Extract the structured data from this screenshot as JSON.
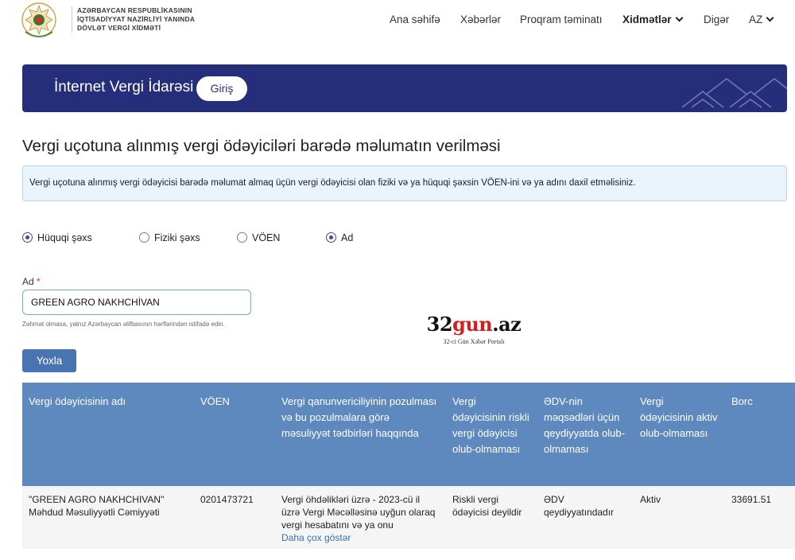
{
  "header": {
    "org_line1": "AZƏRBAYCAN RESPUBLİKASININ",
    "org_line2": "İQTİSADİYYAT NAZİRLİYİ YANINDA",
    "org_line3": "DÖVLƏT VERGİ XİDMƏTİ",
    "emblem_icon": "state-emblem-icon",
    "nav": {
      "home": "Ana səhifə",
      "news": "Xəbərlər",
      "software": "Proqram təminatı",
      "services": "Xidmətlər",
      "other": "Digər",
      "language": "AZ"
    }
  },
  "banner": {
    "title": "İnternet Vergi İdarəsi",
    "login_label": "Giriş",
    "background": "#252e7b"
  },
  "page_title": "Vergi uçotuna alınmış vergi ödəyiciləri barədə məlumatın verilməsi",
  "info_text": "Vergi uçotuna alınmış vergi ödəyicisi barədə məlumat almaq üçün vergi ödəyicisi olan fiziki və ya hüquqi şəxsin VÖEN-ini və ya adını daxil etməlisiniz.",
  "person_type": {
    "legal": "Hüquqi şəxs",
    "natural": "Fiziki şəxs",
    "selected": "legal"
  },
  "search_by": {
    "tin": "VÖEN",
    "name": "Ad",
    "selected": "name"
  },
  "form": {
    "name_label": "Ad",
    "required_mark": "*",
    "name_value": "GREEN AGRO NAKHCHİVAN",
    "hint": "Zəhmət olmasa, yalnız Azərbaycan əlifbasının hərflərindən istifadə edin.",
    "submit_label": "Yoxla"
  },
  "watermark": {
    "part1": "32",
    "part2": "gun",
    "part3": ".az",
    "subtitle": "32-ci Gün Xəbər Portalı"
  },
  "table": {
    "headers": [
      "Vergi ödəyicisinin adı",
      "VÖEN",
      "Vergi qanunvericiliyinin pozulması və bu pozulmalara görə məsuliyyət tədbirləri haqqında",
      "Vergi ödəyicisinin riskli vergi ödəyicisi olub-olmaması",
      "ƏDV-nin məqsədləri üçün qeydiyyatda olub-olmaması",
      "Vergi ödəyicisinin aktiv olub-olmaması",
      "Borc"
    ],
    "rows": [
      {
        "name": "\"GREEN AGRO NAKHCHIVAN\" Məhdud Məsuliyyətli Cəmiyyəti",
        "tin": "0201473721",
        "violations": "Vergi öhdəlikləri üzrə - 2023-cü il üzrə Vergi Məcəlləsinə uyğun olaraq vergi hesabatını və ya onu",
        "violations_more": "Daha çox göstər",
        "risk": "Riskli vergi ödəyicisi deyildir",
        "vat": "ƏDV qeydiyyatındadır",
        "active": "Aktiv",
        "debt": "33691.51"
      }
    ],
    "header_color": "#5d89bf"
  }
}
